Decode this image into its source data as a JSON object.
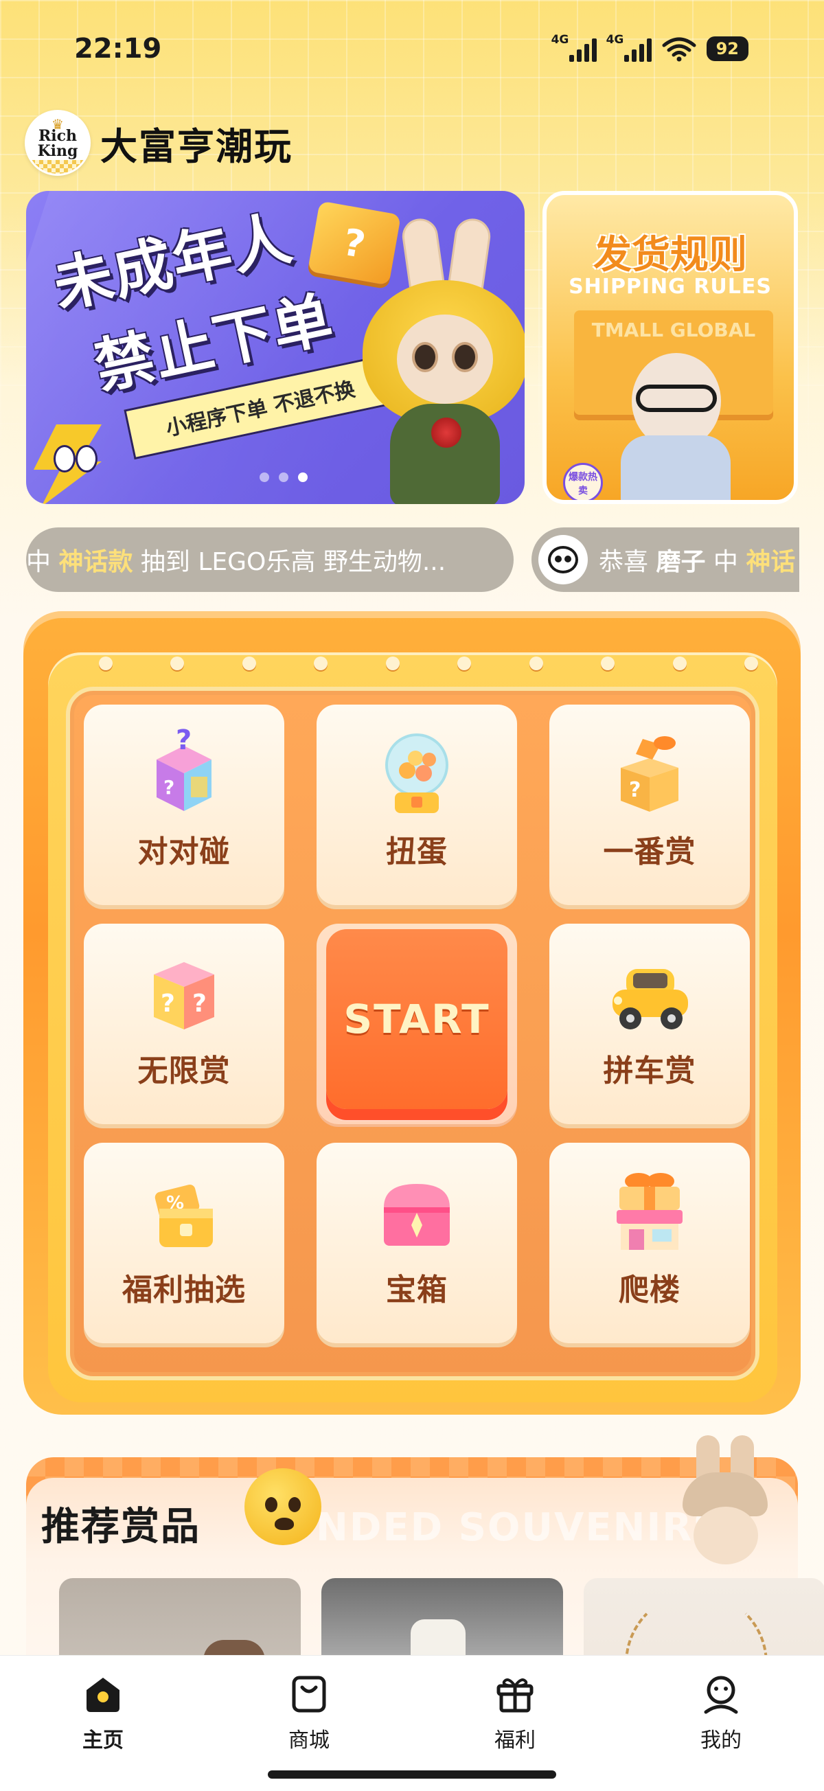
{
  "status": {
    "time": "22:19",
    "network1": "4G",
    "network2": "4G",
    "battery": "92"
  },
  "header": {
    "logo_line1": "Rich",
    "logo_line2": "King",
    "title": "大富亨潮玩"
  },
  "banners": {
    "main": {
      "headline1": "未成年人",
      "headline2": "禁止下单",
      "ribbon": "小程序下单 不退不换",
      "page_count": 3,
      "active_index": 2
    },
    "side": {
      "title": "发货规则",
      "subtitle": "SHIPPING RULES",
      "brand": "TMALL GLOBAL",
      "tag": "爆款热卖"
    }
  },
  "marquee": {
    "item1_prefix": "中 ",
    "item1_highlight": "神话款",
    "item1_text": " 抽到 LEGO乐高 野生动物...",
    "item2_prefix": "恭喜 ",
    "item2_name": "磨子",
    "item2_mid": " 中 ",
    "item2_highlight": "神话"
  },
  "game_board": {
    "tiles": [
      {
        "label": "对对碰",
        "icon": "mystery-box-icon"
      },
      {
        "label": "扭蛋",
        "icon": "gashapon-icon"
      },
      {
        "label": "一番赏",
        "icon": "gift-box-icon"
      },
      {
        "label": "无限赏",
        "icon": "question-cube-icon"
      },
      {
        "label": "拼车赏",
        "icon": "car-icon"
      },
      {
        "label": "福利抽选",
        "icon": "coupon-box-icon"
      },
      {
        "label": "宝箱",
        "icon": "treasure-chest-icon"
      },
      {
        "label": "爬楼",
        "icon": "gift-shop-icon"
      }
    ],
    "start_label": "START"
  },
  "recommend": {
    "title": "推荐赏品",
    "ghost_text": "NDED SOUVENIRS"
  },
  "tabbar": {
    "items": [
      {
        "label": "主页",
        "icon": "home-icon"
      },
      {
        "label": "商城",
        "icon": "shopping-bag-icon"
      },
      {
        "label": "福利",
        "icon": "gift-icon"
      },
      {
        "label": "我的",
        "icon": "profile-icon"
      }
    ],
    "active": "主页"
  },
  "colors": {
    "accent": "#ff7a3a",
    "tile_text": "#8a3f1a",
    "highlight": "#fde07a"
  }
}
